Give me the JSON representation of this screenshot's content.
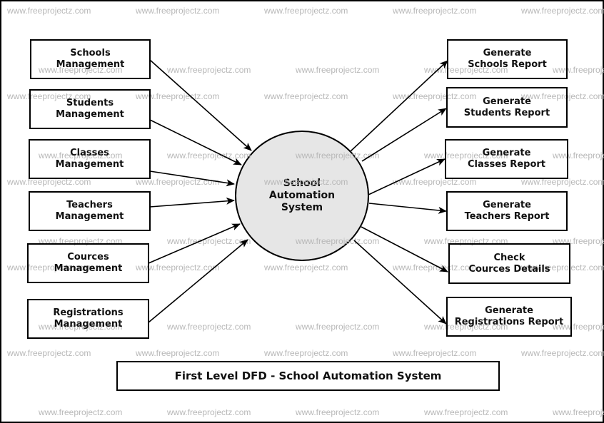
{
  "diagram": {
    "title": "First Level DFD - School Automation System",
    "center_process": {
      "line1": "School",
      "line2": "Automation",
      "line3": "System"
    },
    "inputs": [
      {
        "line1": "Schools",
        "line2": "Management"
      },
      {
        "line1": "Students",
        "line2": "Management"
      },
      {
        "line1": "Classes",
        "line2": "Management"
      },
      {
        "line1": "Teachers",
        "line2": "Management"
      },
      {
        "line1": "Cources",
        "line2": "Management"
      },
      {
        "line1": "Registrations",
        "line2": "Management"
      }
    ],
    "outputs": [
      {
        "line1": "Generate",
        "line2": "Schools Report"
      },
      {
        "line1": "Generate",
        "line2": "Students Report"
      },
      {
        "line1": "Generate",
        "line2": "Classes Report"
      },
      {
        "line1": "Generate",
        "line2": "Teachers Report"
      },
      {
        "line1": "Check",
        "line2": "Cources Details"
      },
      {
        "line1": "Generate",
        "line2": "Registrations Report"
      }
    ],
    "watermark": "www.freeprojectz.com"
  }
}
